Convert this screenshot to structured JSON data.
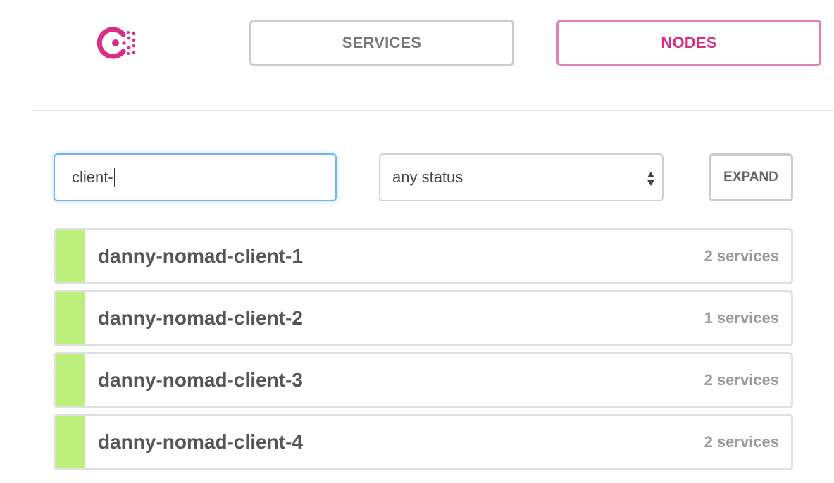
{
  "brand": {
    "logo_icon": "consul-logo-icon",
    "accent_color": "#d62f86"
  },
  "nav": {
    "services_label": "SERVICES",
    "nodes_label": "NODES",
    "active": "NODES"
  },
  "filters": {
    "search_value": "client-",
    "status_selected": "any status",
    "expand_label": "EXPAND"
  },
  "nodes": [
    {
      "name": "danny-nomad-client-1",
      "services": "2 services",
      "health": "passing",
      "health_color": "#bcef7c"
    },
    {
      "name": "danny-nomad-client-2",
      "services": "1 services",
      "health": "passing",
      "health_color": "#bcef7c"
    },
    {
      "name": "danny-nomad-client-3",
      "services": "2 services",
      "health": "passing",
      "health_color": "#bcef7c"
    },
    {
      "name": "danny-nomad-client-4",
      "services": "2 services",
      "health": "passing",
      "health_color": "#bcef7c"
    }
  ]
}
